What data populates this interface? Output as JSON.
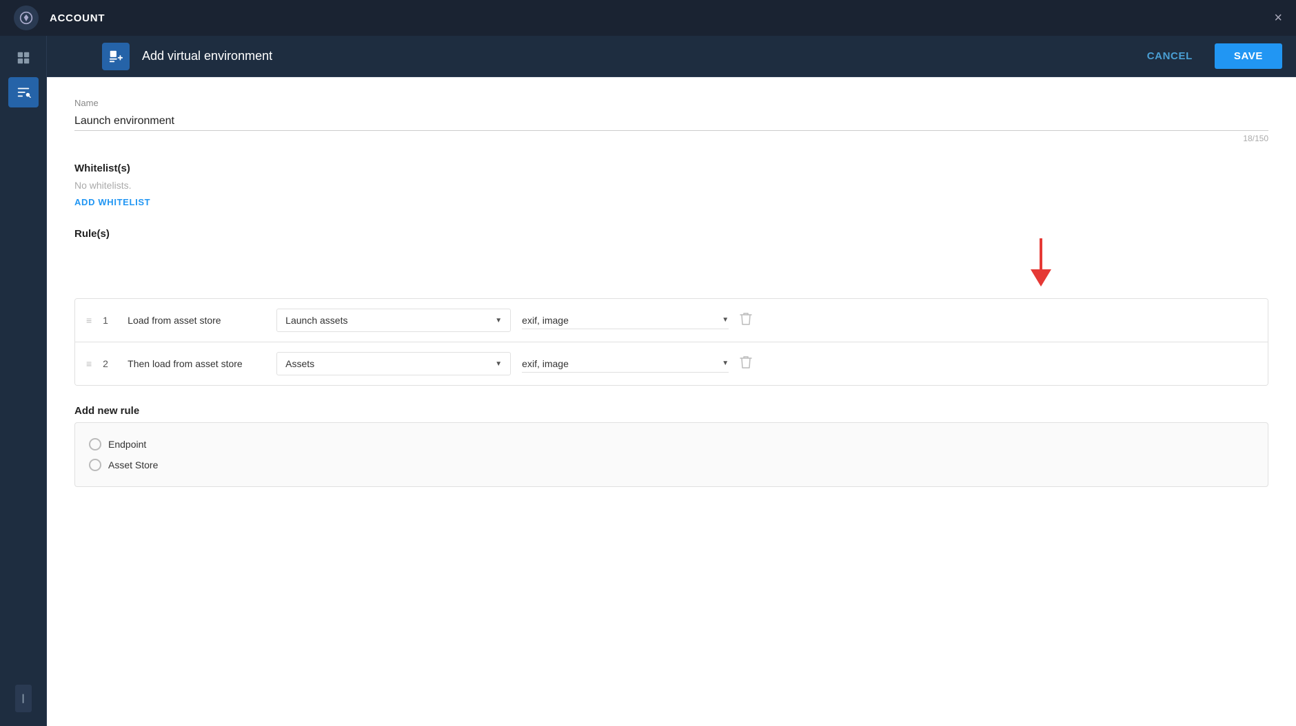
{
  "topbar": {
    "title": "ACCOUNT",
    "close_label": "×"
  },
  "subheader": {
    "title": "Add virtual environment",
    "cancel_label": "CANCEL",
    "save_label": "SAVE"
  },
  "form": {
    "name_label": "Name",
    "name_value": "Launch environment",
    "char_count": "18/150",
    "whitelists_title": "Whitelist(s)",
    "no_whitelists_text": "No whitelists.",
    "add_whitelist_label": "ADD WHITELIST",
    "rules_title": "Rule(s)",
    "rules": [
      {
        "num": "1",
        "label": "Load from asset store",
        "store_value": "Launch assets",
        "tags_value": "exif, image"
      },
      {
        "num": "2",
        "label": "Then load from asset store",
        "store_value": "Assets",
        "tags_value": "exif, image"
      }
    ],
    "add_rule_title": "Add new rule",
    "add_rule_options": [
      {
        "label": "Endpoint"
      },
      {
        "label": "Asset Store"
      }
    ]
  }
}
